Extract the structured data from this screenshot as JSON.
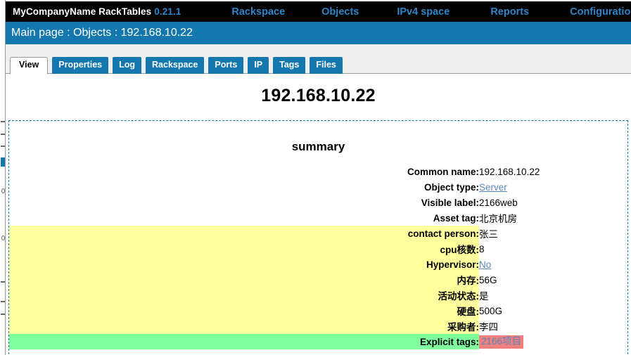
{
  "topnav": {
    "brand_name": "MyCompanyName RackTables",
    "version": "0.21.1",
    "links": [
      {
        "label": "Rackspace",
        "id": "rackspace"
      },
      {
        "label": "Objects",
        "id": "objects"
      },
      {
        "label": "IPv4 space",
        "id": "ipv4-space"
      },
      {
        "label": "Reports",
        "id": "reports"
      },
      {
        "label": "Configuration",
        "id": "configuration"
      }
    ]
  },
  "breadcrumb": {
    "text": "Main page : Objects : 192.168.10.22"
  },
  "tabs": [
    {
      "label": "View",
      "active": true
    },
    {
      "label": "Properties",
      "active": false
    },
    {
      "label": "Log",
      "active": false
    },
    {
      "label": "Rackspace",
      "active": false
    },
    {
      "label": "Ports",
      "active": false
    },
    {
      "label": "IP",
      "active": false
    },
    {
      "label": "Tags",
      "active": false
    },
    {
      "label": "Files",
      "active": false
    }
  ],
  "content": {
    "page_title": "192.168.10.22",
    "summary_title": "summary",
    "rows": [
      {
        "label": "Common name:",
        "value": "192.168.10.22",
        "style": "plain",
        "value_kind": "text"
      },
      {
        "label": "Object type:",
        "value": "Server",
        "style": "plain",
        "value_kind": "link"
      },
      {
        "label": "Visible label:",
        "value": "2166web",
        "style": "plain",
        "value_kind": "text"
      },
      {
        "label": "Asset tag:",
        "value": "北京机房",
        "style": "plain",
        "value_kind": "text"
      },
      {
        "label": "contact person:",
        "value": "张三",
        "style": "yellow",
        "value_kind": "text"
      },
      {
        "label": "cpu核数:",
        "value": "8",
        "style": "yellow",
        "value_kind": "text"
      },
      {
        "label": "Hypervisor:",
        "value": "No",
        "style": "yellow",
        "value_kind": "link"
      },
      {
        "label": "内存:",
        "value": "56G",
        "style": "yellow",
        "value_kind": "text"
      },
      {
        "label": "活动状态:",
        "value": "是",
        "style": "yellow",
        "value_kind": "text"
      },
      {
        "label": "硬盘:",
        "value": "500G",
        "style": "yellow",
        "value_kind": "text"
      },
      {
        "label": "采购者:",
        "value": "李四",
        "style": "yellow",
        "value_kind": "text"
      },
      {
        "label": "Explicit tags:",
        "value": "2166项目",
        "style": "green",
        "value_kind": "tag"
      }
    ]
  },
  "colors": {
    "nav_background": "#000000",
    "nav_link": "#2e86c8",
    "breadcrumb_background": "#1477ad",
    "tab_background": "#1477ad",
    "highlight_yellow": "#ffff9d",
    "highlight_green": "#80ff9f",
    "tag_background": "#f08080",
    "link_text": "#5b87b8"
  }
}
